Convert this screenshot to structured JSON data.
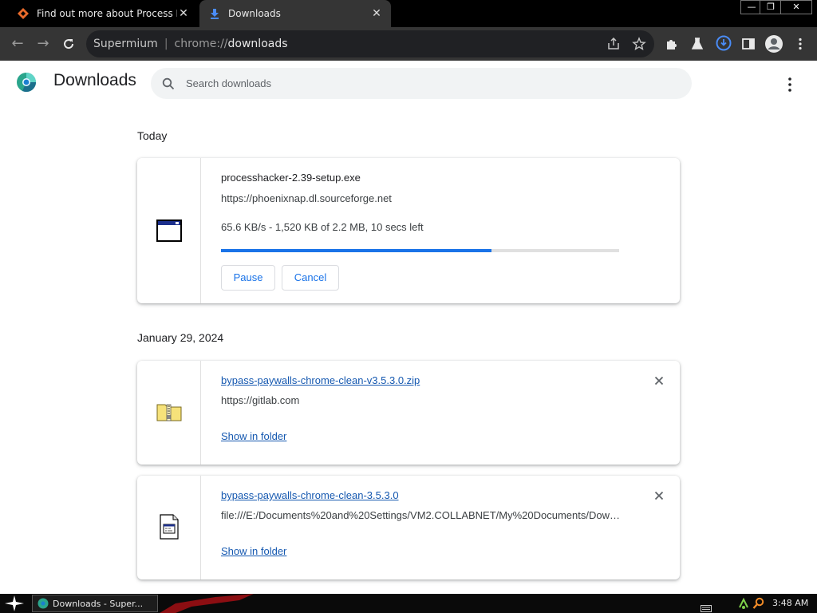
{
  "tabs": [
    {
      "title": "Find out more about Process Hacker",
      "icon": "process-hacker-favicon",
      "active": false
    },
    {
      "title": "Downloads",
      "icon": "download-favicon",
      "active": true
    }
  ],
  "window_controls": {
    "minimize": "—",
    "restore": "❐",
    "close": "✕"
  },
  "toolbar": {
    "omnibox_brand": "Supermium",
    "url_scheme": "chrome://",
    "url_host": "downloads"
  },
  "page": {
    "title": "Downloads",
    "search_placeholder": "Search downloads"
  },
  "groups": [
    {
      "date": "Today",
      "items": [
        {
          "file_name": "processhacker-2.39-setup.exe",
          "source": "https://phoenixnap.dl.sourceforge.net",
          "status": "65.6 KB/s - 1,520 KB of 2.2 MB, 10 secs left",
          "progress_fraction": 0.68,
          "pause_label": "Pause",
          "cancel_label": "Cancel",
          "icon": "executable-window-icon"
        }
      ]
    },
    {
      "date": "January 29, 2024",
      "items": [
        {
          "file_name": "bypass-paywalls-chrome-clean-v3.5.3.0.zip",
          "source": "https://gitlab.com",
          "action": "Show in folder",
          "icon": "zip-folder-icon"
        },
        {
          "file_name": "bypass-paywalls-chrome-clean-3.5.3.0",
          "source": "file:///E:/Documents%20and%20Settings/VM2.COLLABNET/My%20Documents/Down...",
          "action": "Show in folder",
          "icon": "file-icon"
        }
      ]
    }
  ],
  "taskbar": {
    "task_label": "Downloads - Super...",
    "clock": "3:48 AM"
  },
  "colors": {
    "accent": "#1a73e8",
    "tab_strip": "#000000",
    "toolbar": "#353535",
    "omnibox": "#202124"
  }
}
